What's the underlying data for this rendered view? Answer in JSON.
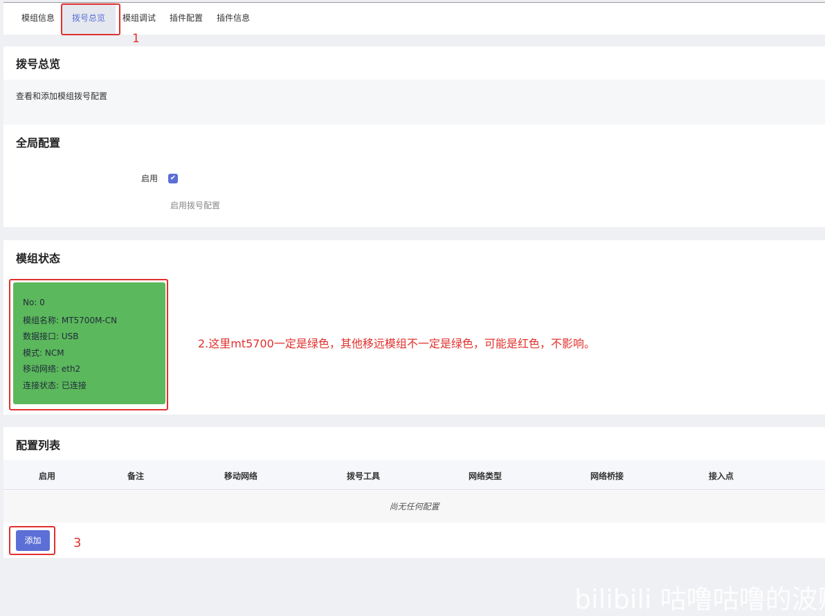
{
  "tabs": [
    "模组信息",
    "拨号总览",
    "模组调试",
    "插件配置",
    "插件信息"
  ],
  "active_tab": 1,
  "header": {
    "title": "拨号总览",
    "description": "查看和添加模组拨号配置"
  },
  "global": {
    "title": "全局配置",
    "enable_label": "启用",
    "enable_checked": true,
    "enable_hint": "启用拨号配置"
  },
  "module_status": {
    "title": "模组状态",
    "card_color": "#5cb85c",
    "lines": [
      "No: 0",
      "模组名称: MT5700M-CN",
      "数据接口: USB",
      "模式: NCM",
      "移动网络: eth2",
      "连接状态: 已连接"
    ]
  },
  "config_list": {
    "title": "配置列表",
    "columns": [
      "启用",
      "备注",
      "移动网络",
      "拨号工具",
      "网络类型",
      "网络桥接",
      "接入点"
    ],
    "empty_text": "尚无任何配置",
    "add_label": "添加"
  },
  "annotations": {
    "a1": "1",
    "a2": "2.这里mt5700一定是绿色，其他移远模组不一定是绿色，可能是红色，不影响。",
    "a3": "3"
  },
  "watermark": "bilibili 咕噜咕噜的波贩"
}
